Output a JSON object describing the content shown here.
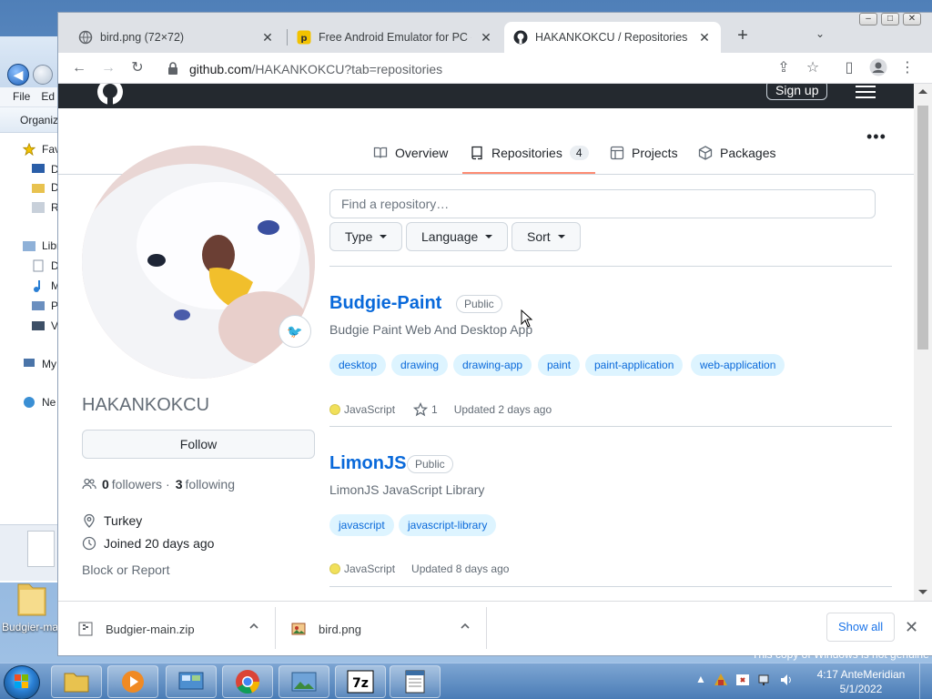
{
  "browser": {
    "tabs": [
      {
        "title": "bird.png (72×72)",
        "favicon": "globe-icon",
        "active": false
      },
      {
        "title": "Free Android Emulator for PC - D",
        "favicon": "emulator-icon",
        "active": false
      },
      {
        "title": "HAKANKOKCU / Repositories · G",
        "favicon": "github-icon",
        "active": true
      }
    ],
    "url_domain": "github.com",
    "url_path": "/HAKANKOKCU?tab=repositories"
  },
  "github": {
    "signup_label": "Sign up",
    "nav": [
      {
        "label": "Overview",
        "icon": "book-icon"
      },
      {
        "label": "Repositories",
        "icon": "repo-icon",
        "count": "4"
      },
      {
        "label": "Projects",
        "icon": "table-icon"
      },
      {
        "label": "Packages",
        "icon": "package-icon"
      }
    ],
    "profile": {
      "username": "HAKANKOKCU",
      "follow_label": "Follow",
      "followers_count": "0",
      "followers_label": "followers",
      "separator": "·",
      "following_count": "3",
      "following_label": "following",
      "location": "Turkey",
      "joined": "Joined 20 days ago",
      "block_label": "Block or Report",
      "badge_emoji": "🐦"
    },
    "search_placeholder": "Find a repository…",
    "filters": [
      "Type",
      "Language",
      "Sort"
    ],
    "repos": [
      {
        "name": "Budgie-Paint",
        "visibility": "Public",
        "description": "Budgie Paint Web And Desktop App",
        "topics": [
          "desktop",
          "drawing",
          "drawing-app",
          "paint",
          "paint-application",
          "web-application"
        ],
        "language": "JavaScript",
        "stars": "1",
        "updated": "Updated 2 days ago"
      },
      {
        "name": "LimonJS",
        "visibility": "Public",
        "description": "LimonJS JavaScript Library",
        "topics": [
          "javascript",
          "javascript-library"
        ],
        "language": "JavaScript",
        "updated": "Updated 8 days ago"
      }
    ]
  },
  "downloads": {
    "items": [
      {
        "name": "Budgier-main.zip",
        "icon": "zip-file-icon"
      },
      {
        "name": "bird.png",
        "icon": "image-file-icon"
      }
    ],
    "show_all_label": "Show all"
  },
  "explorer": {
    "menu": [
      "File",
      "Ed"
    ],
    "organize": "Organiz",
    "tree": [
      "Fav",
      "D",
      "D",
      "R",
      "Libr",
      "D",
      "M",
      "P",
      "V",
      "My",
      "Ne"
    ]
  },
  "desktop": {
    "folder_label": "Budgier-ma",
    "genuine_notice": "This copy of Windows is not genuine"
  },
  "taskbar": {
    "time": "4:17 AnteMeridian",
    "date": "5/1/2022"
  },
  "colors": {
    "link": "#0969da",
    "nav_underline": "#fd8c73",
    "javascript": "#f1e05a",
    "topic_bg": "#ddf4ff",
    "header_bg": "#24292f"
  }
}
